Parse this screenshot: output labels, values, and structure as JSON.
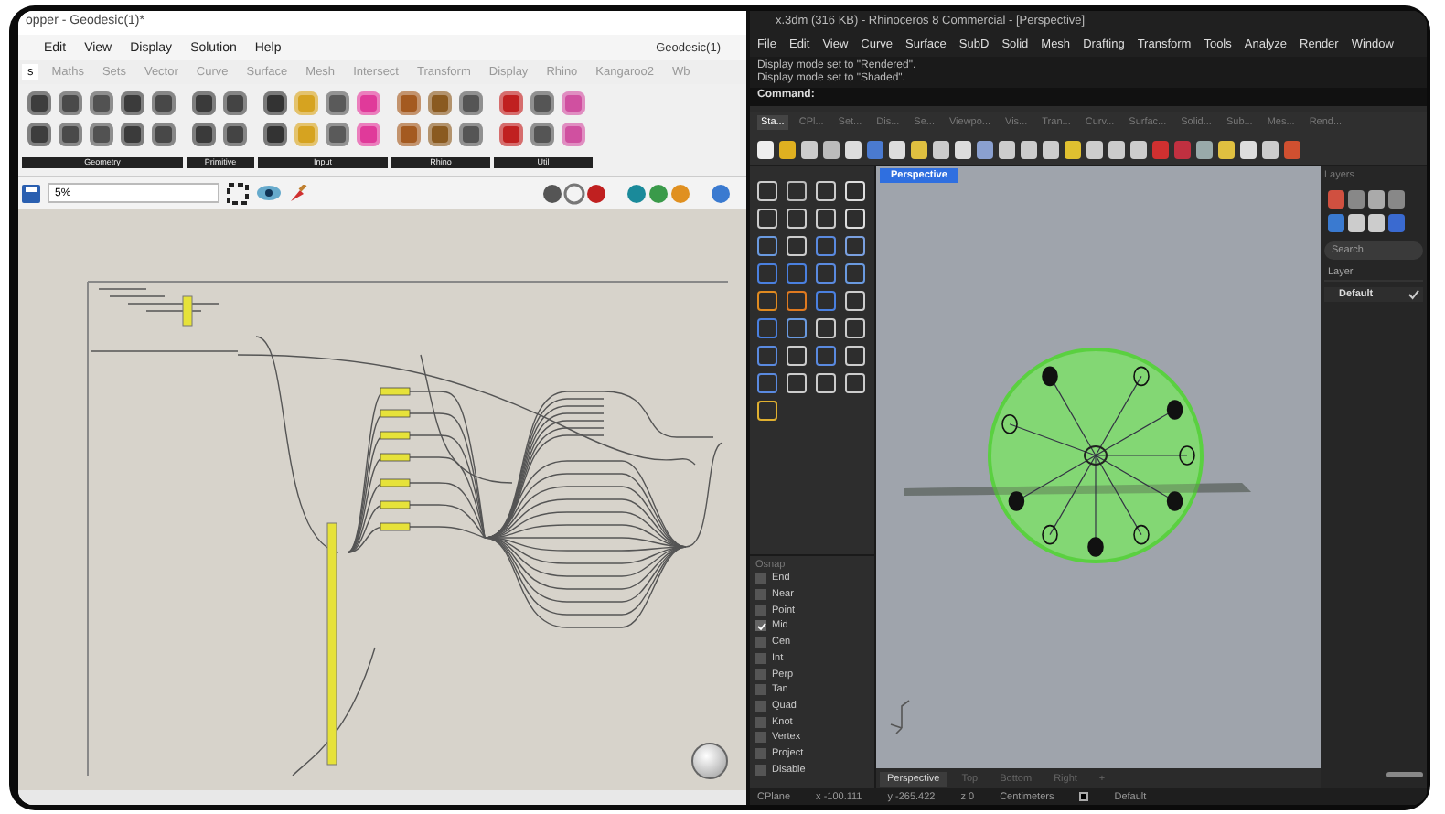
{
  "grasshopper": {
    "title": "opper - Geodesic(1)*",
    "menu": [
      "Edit",
      "View",
      "Display",
      "Solution",
      "Help"
    ],
    "document": "Geodesic(1)",
    "tabs": [
      {
        "label": "s",
        "selected": true
      },
      {
        "label": "Maths",
        "selected": false
      },
      {
        "label": "Sets",
        "selected": false
      },
      {
        "label": "Vector",
        "selected": false
      },
      {
        "label": "Curve",
        "selected": false
      },
      {
        "label": "Surface",
        "selected": false
      },
      {
        "label": "Mesh",
        "selected": false
      },
      {
        "label": "Intersect",
        "selected": false
      },
      {
        "label": "Transform",
        "selected": false
      },
      {
        "label": "Display",
        "selected": false
      },
      {
        "label": "Rhino",
        "selected": false
      },
      {
        "label": "Kangaroo2",
        "selected": false
      },
      {
        "label": "Wb",
        "selected": false
      }
    ],
    "ribbon_groups": [
      "Geometry",
      "Primitive",
      "Input",
      "Rhino",
      "Util"
    ],
    "zoom": "5%"
  },
  "rhino": {
    "title": "x.3dm (316 KB) - Rhinoceros 8 Commercial - [Perspective]",
    "menu": [
      "File",
      "Edit",
      "View",
      "Curve",
      "Surface",
      "SubD",
      "Solid",
      "Mesh",
      "Drafting",
      "Transform",
      "Tools",
      "Analyze",
      "Render",
      "Window"
    ],
    "command_history": [
      "Display mode set to \"Rendered\".",
      "Display mode set to \"Shaded\"."
    ],
    "command_label": "Command:",
    "toolbar_tabs": [
      {
        "label": "Sta...",
        "selected": true
      },
      {
        "label": "CPl...",
        "selected": false
      },
      {
        "label": "Set...",
        "selected": false
      },
      {
        "label": "Dis...",
        "selected": false
      },
      {
        "label": "Se...",
        "selected": false
      },
      {
        "label": "Viewpo...",
        "selected": false
      },
      {
        "label": "Vis...",
        "selected": false
      },
      {
        "label": "Tran...",
        "selected": false
      },
      {
        "label": "Curv...",
        "selected": false
      },
      {
        "label": "Surfac...",
        "selected": false
      },
      {
        "label": "Solid...",
        "selected": false
      },
      {
        "label": "Sub...",
        "selected": false
      },
      {
        "label": "Mes...",
        "selected": false
      },
      {
        "label": "Rend...",
        "selected": false
      }
    ],
    "viewport": {
      "label": "Perspective"
    },
    "osnap": {
      "title": "Osnap",
      "items": [
        {
          "label": "End",
          "checked": false
        },
        {
          "label": "Near",
          "checked": false
        },
        {
          "label": "Point",
          "checked": false
        },
        {
          "label": "Mid",
          "checked": true
        },
        {
          "label": "Cen",
          "checked": false
        },
        {
          "label": "Int",
          "checked": false
        },
        {
          "label": "Perp",
          "checked": false
        },
        {
          "label": "Tan",
          "checked": false
        },
        {
          "label": "Quad",
          "checked": false
        },
        {
          "label": "Knot",
          "checked": false
        },
        {
          "label": "Vertex",
          "checked": false
        },
        {
          "label": "Project",
          "checked": false
        },
        {
          "label": "Disable",
          "checked": false
        }
      ]
    },
    "layers": {
      "title": "Layers",
      "search": {
        "placeholder": "Search"
      },
      "column": "Layer",
      "rows": [
        {
          "name": "Default",
          "current": true
        }
      ]
    },
    "viewport_tabs": [
      {
        "label": "Perspective",
        "selected": true
      },
      {
        "label": "Top",
        "selected": false
      },
      {
        "label": "Bottom",
        "selected": false
      },
      {
        "label": "Right",
        "selected": false
      },
      {
        "label": "+",
        "selected": false
      }
    ],
    "status": {
      "cplane": "CPlane",
      "x": "x -100.111",
      "y": "y -265.422",
      "z": "z 0",
      "units": "Centimeters",
      "layer": "Default"
    }
  }
}
